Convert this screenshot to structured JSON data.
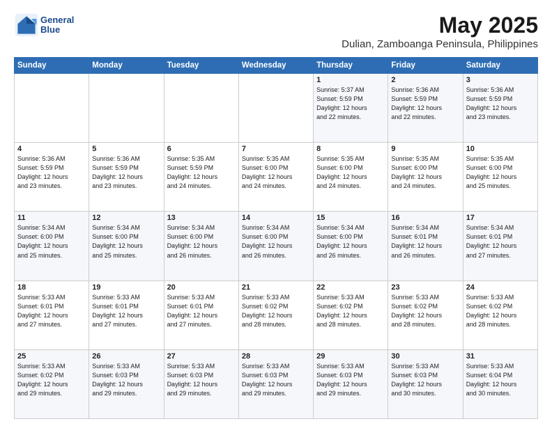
{
  "header": {
    "logo_line1": "General",
    "logo_line2": "Blue",
    "month_year": "May 2025",
    "location": "Dulian, Zamboanga Peninsula, Philippines"
  },
  "weekdays": [
    "Sunday",
    "Monday",
    "Tuesday",
    "Wednesday",
    "Thursday",
    "Friday",
    "Saturday"
  ],
  "weeks": [
    [
      {
        "day": "",
        "info": ""
      },
      {
        "day": "",
        "info": ""
      },
      {
        "day": "",
        "info": ""
      },
      {
        "day": "",
        "info": ""
      },
      {
        "day": "1",
        "info": "Sunrise: 5:37 AM\nSunset: 5:59 PM\nDaylight: 12 hours\nand 22 minutes."
      },
      {
        "day": "2",
        "info": "Sunrise: 5:36 AM\nSunset: 5:59 PM\nDaylight: 12 hours\nand 22 minutes."
      },
      {
        "day": "3",
        "info": "Sunrise: 5:36 AM\nSunset: 5:59 PM\nDaylight: 12 hours\nand 23 minutes."
      }
    ],
    [
      {
        "day": "4",
        "info": "Sunrise: 5:36 AM\nSunset: 5:59 PM\nDaylight: 12 hours\nand 23 minutes."
      },
      {
        "day": "5",
        "info": "Sunrise: 5:36 AM\nSunset: 5:59 PM\nDaylight: 12 hours\nand 23 minutes."
      },
      {
        "day": "6",
        "info": "Sunrise: 5:35 AM\nSunset: 5:59 PM\nDaylight: 12 hours\nand 24 minutes."
      },
      {
        "day": "7",
        "info": "Sunrise: 5:35 AM\nSunset: 6:00 PM\nDaylight: 12 hours\nand 24 minutes."
      },
      {
        "day": "8",
        "info": "Sunrise: 5:35 AM\nSunset: 6:00 PM\nDaylight: 12 hours\nand 24 minutes."
      },
      {
        "day": "9",
        "info": "Sunrise: 5:35 AM\nSunset: 6:00 PM\nDaylight: 12 hours\nand 24 minutes."
      },
      {
        "day": "10",
        "info": "Sunrise: 5:35 AM\nSunset: 6:00 PM\nDaylight: 12 hours\nand 25 minutes."
      }
    ],
    [
      {
        "day": "11",
        "info": "Sunrise: 5:34 AM\nSunset: 6:00 PM\nDaylight: 12 hours\nand 25 minutes."
      },
      {
        "day": "12",
        "info": "Sunrise: 5:34 AM\nSunset: 6:00 PM\nDaylight: 12 hours\nand 25 minutes."
      },
      {
        "day": "13",
        "info": "Sunrise: 5:34 AM\nSunset: 6:00 PM\nDaylight: 12 hours\nand 26 minutes."
      },
      {
        "day": "14",
        "info": "Sunrise: 5:34 AM\nSunset: 6:00 PM\nDaylight: 12 hours\nand 26 minutes."
      },
      {
        "day": "15",
        "info": "Sunrise: 5:34 AM\nSunset: 6:00 PM\nDaylight: 12 hours\nand 26 minutes."
      },
      {
        "day": "16",
        "info": "Sunrise: 5:34 AM\nSunset: 6:01 PM\nDaylight: 12 hours\nand 26 minutes."
      },
      {
        "day": "17",
        "info": "Sunrise: 5:34 AM\nSunset: 6:01 PM\nDaylight: 12 hours\nand 27 minutes."
      }
    ],
    [
      {
        "day": "18",
        "info": "Sunrise: 5:33 AM\nSunset: 6:01 PM\nDaylight: 12 hours\nand 27 minutes."
      },
      {
        "day": "19",
        "info": "Sunrise: 5:33 AM\nSunset: 6:01 PM\nDaylight: 12 hours\nand 27 minutes."
      },
      {
        "day": "20",
        "info": "Sunrise: 5:33 AM\nSunset: 6:01 PM\nDaylight: 12 hours\nand 27 minutes."
      },
      {
        "day": "21",
        "info": "Sunrise: 5:33 AM\nSunset: 6:02 PM\nDaylight: 12 hours\nand 28 minutes."
      },
      {
        "day": "22",
        "info": "Sunrise: 5:33 AM\nSunset: 6:02 PM\nDaylight: 12 hours\nand 28 minutes."
      },
      {
        "day": "23",
        "info": "Sunrise: 5:33 AM\nSunset: 6:02 PM\nDaylight: 12 hours\nand 28 minutes."
      },
      {
        "day": "24",
        "info": "Sunrise: 5:33 AM\nSunset: 6:02 PM\nDaylight: 12 hours\nand 28 minutes."
      }
    ],
    [
      {
        "day": "25",
        "info": "Sunrise: 5:33 AM\nSunset: 6:02 PM\nDaylight: 12 hours\nand 29 minutes."
      },
      {
        "day": "26",
        "info": "Sunrise: 5:33 AM\nSunset: 6:03 PM\nDaylight: 12 hours\nand 29 minutes."
      },
      {
        "day": "27",
        "info": "Sunrise: 5:33 AM\nSunset: 6:03 PM\nDaylight: 12 hours\nand 29 minutes."
      },
      {
        "day": "28",
        "info": "Sunrise: 5:33 AM\nSunset: 6:03 PM\nDaylight: 12 hours\nand 29 minutes."
      },
      {
        "day": "29",
        "info": "Sunrise: 5:33 AM\nSunset: 6:03 PM\nDaylight: 12 hours\nand 29 minutes."
      },
      {
        "day": "30",
        "info": "Sunrise: 5:33 AM\nSunset: 6:03 PM\nDaylight: 12 hours\nand 30 minutes."
      },
      {
        "day": "31",
        "info": "Sunrise: 5:33 AM\nSunset: 6:04 PM\nDaylight: 12 hours\nand 30 minutes."
      }
    ]
  ]
}
